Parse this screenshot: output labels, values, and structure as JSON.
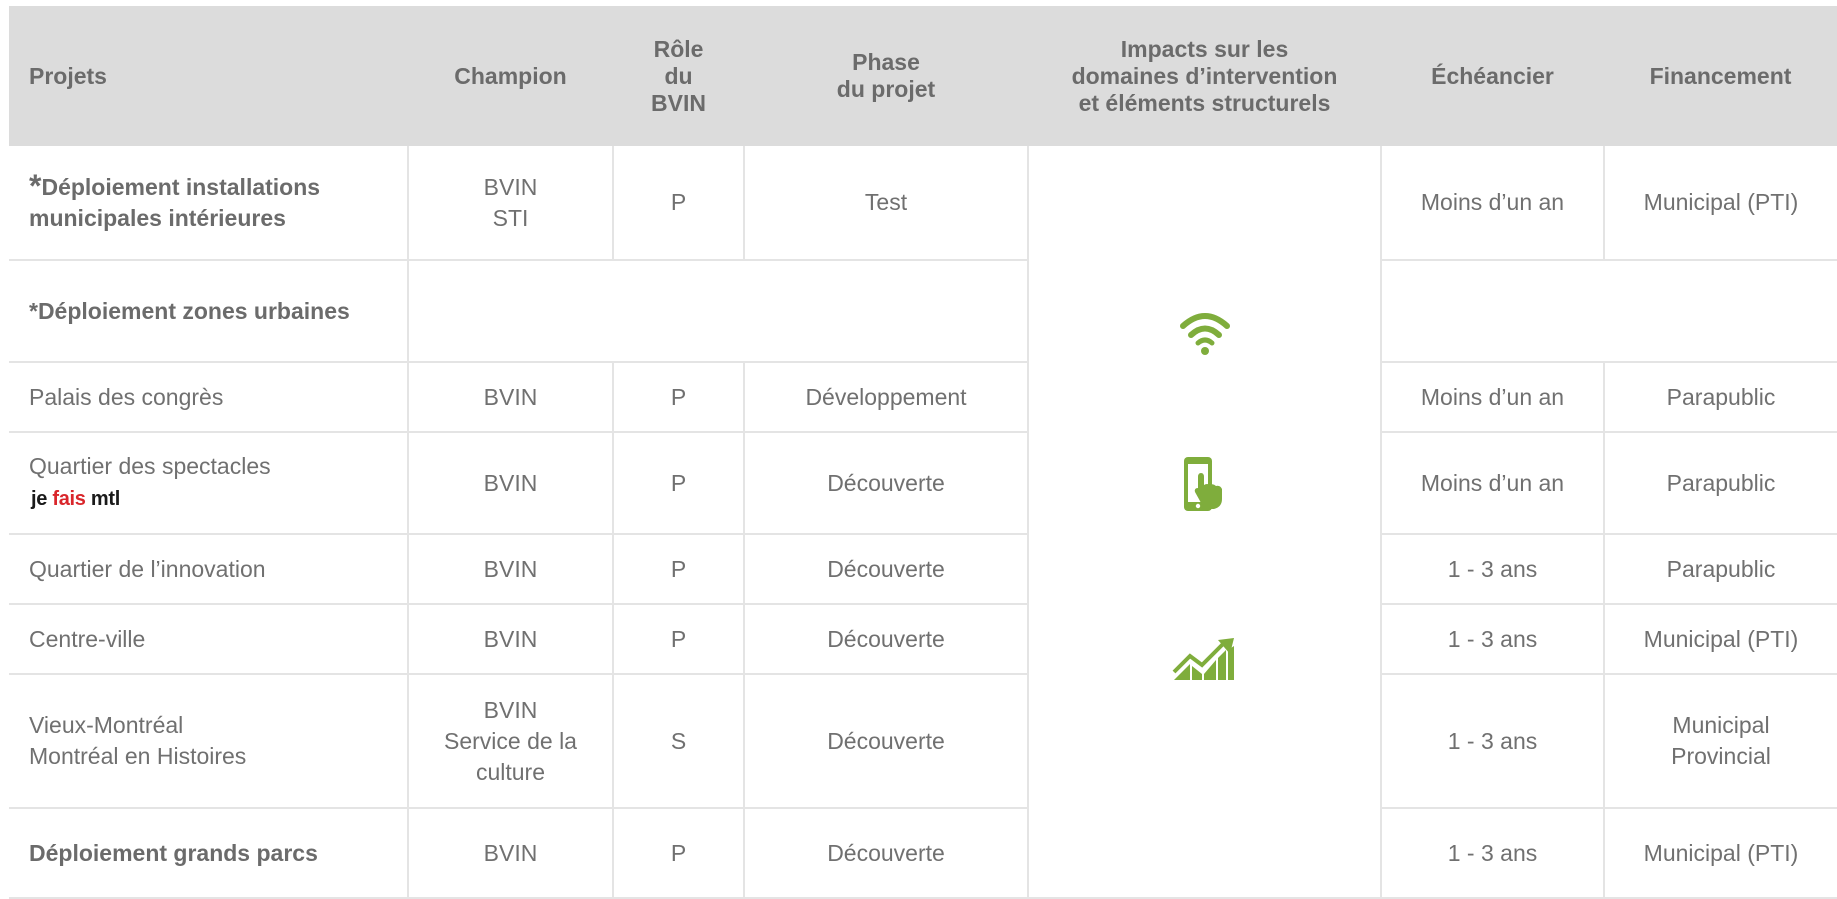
{
  "headers": {
    "projets": "Projets",
    "champion": "Champion",
    "role": [
      "Rôle",
      "du",
      "BVIN"
    ],
    "phase": [
      "Phase",
      "du projet"
    ],
    "impacts": [
      "Impacts sur les",
      "domaines d’intervention",
      "et éléments structurels"
    ],
    "echeancier": "Échéancier",
    "financement": "Financement"
  },
  "rows": {
    "r1": {
      "star": "*",
      "project": "Déploiement installations municipales intérieures",
      "champion": [
        "BVIN",
        "STI"
      ],
      "role": "P",
      "phase": "Test",
      "echeancier": "Moins d’un an",
      "financement": "Municipal (PTI)"
    },
    "r2": {
      "project": "*Déploiement zones urbaines"
    },
    "r3": {
      "project": "Palais des congrès",
      "champion": "BVIN",
      "role": "P",
      "phase": "Développement",
      "echeancier": "Moins d’un an",
      "financement": "Parapublic"
    },
    "r4": {
      "project": "Quartier des spectacles",
      "logo": [
        "je",
        "fais",
        "mtl"
      ],
      "champion": "BVIN",
      "role": "P",
      "phase": "Découverte",
      "echeancier": "Moins d’un an",
      "financement": "Parapublic"
    },
    "r5": {
      "project": "Quartier de l’innovation",
      "champion": "BVIN",
      "role": "P",
      "phase": "Découverte",
      "echeancier": "1 - 3 ans",
      "financement": "Parapublic"
    },
    "r6": {
      "project": "Centre-ville",
      "champion": "BVIN",
      "role": "P",
      "phase": "Découverte",
      "echeancier": "1 - 3 ans",
      "financement": "Municipal (PTI)"
    },
    "r7": {
      "project": [
        "Vieux-Montréal",
        "Montréal en Histoires"
      ],
      "champion": [
        "BVIN",
        "Service de la",
        "culture"
      ],
      "role": "S",
      "phase": "Découverte",
      "echeancier": "1 - 3 ans",
      "financement": [
        "Municipal",
        "Provincial"
      ]
    },
    "r8": {
      "project": "Déploiement grands parcs",
      "champion": "BVIN",
      "role": "P",
      "phase": "Découverte",
      "echeancier": "1 - 3 ans",
      "financement": "Municipal (PTI)"
    }
  },
  "impact_icons": [
    "wifi-icon",
    "smartphone-touch-icon",
    "growth-chart-icon"
  ],
  "colors": {
    "accent_green": "#7fad3c",
    "header_bg": "#dcdcdc",
    "logo_red": "#d9262b"
  }
}
